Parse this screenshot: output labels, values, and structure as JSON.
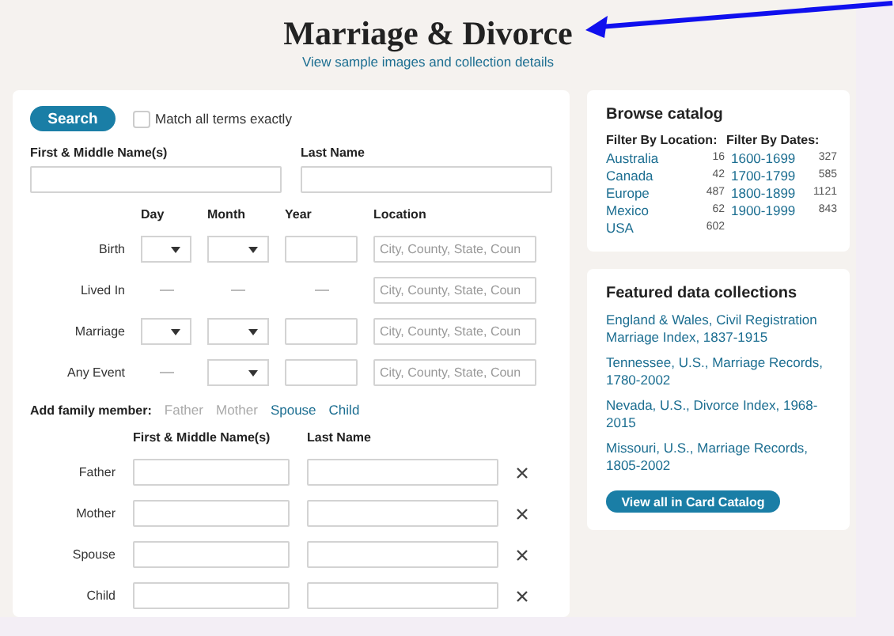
{
  "page": {
    "title": "Marriage & Divorce",
    "details_link": "View sample images and collection details"
  },
  "search_form": {
    "search_button": "Search",
    "exact_match": {
      "label": "Match all terms exactly",
      "checked": false
    },
    "name_fields": [
      {
        "label": "First & Middle Name(s)"
      },
      {
        "label": "Last Name"
      }
    ],
    "event_columns": [
      "Day",
      "Month",
      "Year",
      "Location"
    ],
    "events": [
      {
        "label": "Birth",
        "date_fields": [
          {
            "kind": "select"
          },
          {
            "kind": "select"
          },
          {
            "kind": "input"
          }
        ],
        "location_placeholder": "City, County, State, Coun"
      },
      {
        "label": "Lived In",
        "date_fields": [
          {
            "kind": "none"
          },
          {
            "kind": "none"
          },
          {
            "kind": "none"
          }
        ],
        "location_placeholder": "City, County, State, Coun"
      },
      {
        "label": "Marriage",
        "date_fields": [
          {
            "kind": "select"
          },
          {
            "kind": "select"
          },
          {
            "kind": "input"
          }
        ],
        "location_placeholder": "City, County, State, Coun"
      },
      {
        "label": "Any Event",
        "date_fields": [
          {
            "kind": "none"
          },
          {
            "kind": "select"
          },
          {
            "kind": "input"
          }
        ],
        "location_placeholder": "City, County, State, Coun"
      }
    ],
    "family_label": "Add family member:",
    "family_links": [
      {
        "label": "Father",
        "disabled": true
      },
      {
        "label": "Mother",
        "disabled": true
      },
      {
        "label": "Spouse",
        "disabled": false
      },
      {
        "label": "Child",
        "disabled": false
      }
    ],
    "family_columns": [
      "First & Middle Name(s)",
      "Last Name"
    ],
    "family_rows": [
      {
        "label": "Father"
      },
      {
        "label": "Mother"
      },
      {
        "label": "Spouse"
      },
      {
        "label": "Child"
      }
    ]
  },
  "browse_catalog": {
    "title": "Browse catalog",
    "locations": {
      "header": "Filter By Location:",
      "items": [
        {
          "name": "Australia",
          "count": "16"
        },
        {
          "name": "Canada",
          "count": "42"
        },
        {
          "name": "Europe",
          "count": "487"
        },
        {
          "name": "Mexico",
          "count": "62"
        },
        {
          "name": "USA",
          "count": "602"
        }
      ]
    },
    "dates": {
      "header": "Filter By Dates:",
      "items": [
        {
          "name": "1600-1699",
          "count": "327"
        },
        {
          "name": "1700-1799",
          "count": "585"
        },
        {
          "name": "1800-1899",
          "count": "1121"
        },
        {
          "name": "1900-1999",
          "count": "843"
        }
      ]
    }
  },
  "featured": {
    "title": "Featured data collections",
    "items": [
      "England & Wales, Civil Registration Marriage Index, 1837-1915",
      "Tennessee, U.S., Marriage Records, 1780-2002",
      "Nevada, U.S., Divorce Index, 1968-2015",
      "Missouri, U.S., Marriage Records, 1805-2002"
    ],
    "button": "View all in Card Catalog"
  },
  "annotation": {
    "kind": "arrow"
  }
}
